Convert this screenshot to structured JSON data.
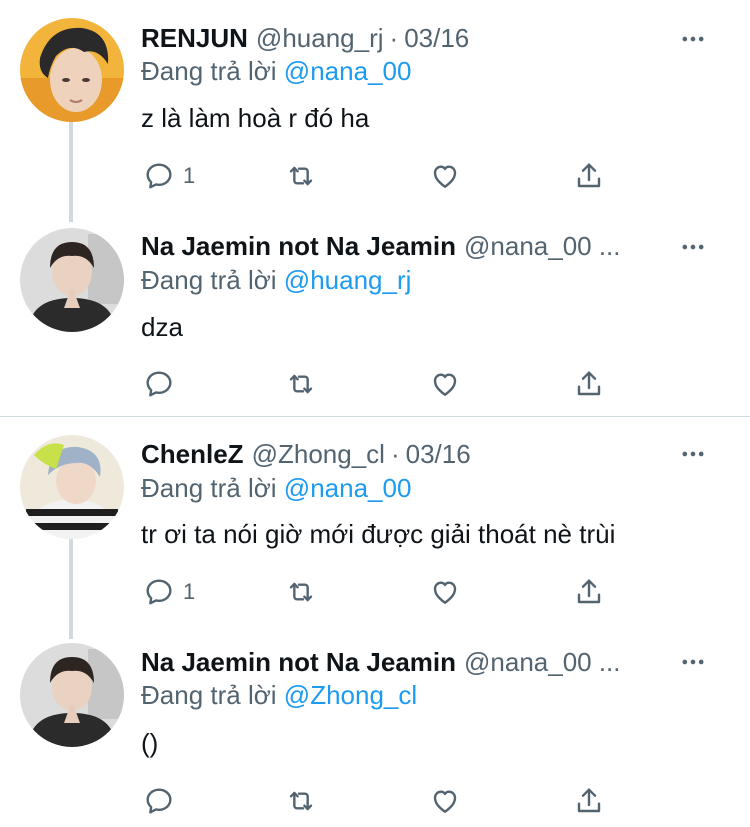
{
  "colors": {
    "accent": "#1d9bf0",
    "muted": "#536471",
    "text": "#0f1419",
    "line": "#cfd9de"
  },
  "reply_prefix": "Đang trả lời",
  "tweets": [
    {
      "name": "RENJUN",
      "handle": "@huang_rj",
      "dot": "·",
      "date": "03/16",
      "reply_to": "@nana_00",
      "text": "z là làm hoà r đó ha",
      "reply_count": "1",
      "avatar_icon": "renjun-avatar"
    },
    {
      "name": "Na Jaemin not Na Jeamin",
      "handle": "@nana_00 ...",
      "dot": "",
      "date": "",
      "reply_to": "@huang_rj",
      "text": "dza",
      "reply_count": "",
      "avatar_icon": "jaemin-avatar"
    },
    {
      "name": "ChenleZ",
      "handle": "@Zhong_cl",
      "dot": "·",
      "date": "03/16",
      "reply_to": "@nana_00",
      "text": "tr ơi ta nói giờ mới được giải thoát nè trùi",
      "reply_count": "1",
      "avatar_icon": "chenle-avatar"
    },
    {
      "name": "Na Jaemin not Na Jeamin",
      "handle": "@nana_00 ...",
      "dot": "",
      "date": "",
      "reply_to": "@Zhong_cl",
      "text": "()",
      "reply_count": "",
      "avatar_icon": "jaemin-avatar"
    }
  ],
  "icons": [
    "reply-icon",
    "retweet-icon",
    "like-icon",
    "share-icon",
    "more-icon"
  ]
}
